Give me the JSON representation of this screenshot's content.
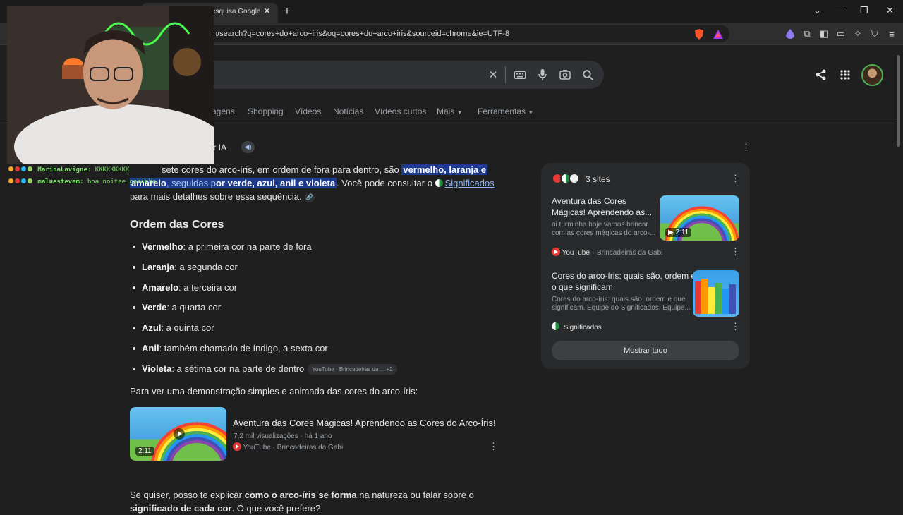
{
  "browser": {
    "tab_title": "esquisa Google",
    "url": "n/search?q=cores+do+arco+iris&oq=cores+do+arco+iris&sourceid=chrome&ie=UTF-8"
  },
  "search": {
    "clear_icon": "close-icon",
    "keyboard_icon": "keyboard-icon",
    "mic_icon": "mic-icon",
    "lens_icon": "lens-icon",
    "search_icon": "search-icon"
  },
  "nav": {
    "tabs": [
      "agens",
      "Shopping",
      "Vídeos",
      "Notícias",
      "Vídeos curtos",
      "Mais",
      "Ferramentas"
    ]
  },
  "ai_overview": {
    "label": "por IA",
    "intro_a": "sete cores do arco-íris, em ordem de fora para dentro, são",
    "intro_hl1": "vermelho, laranja e",
    "intro_hl2a": "amarelo",
    "intro_hl2b": ", seguidas p",
    "intro_hl2c": "or",
    "intro_hl2d": "verde, azul, anil e violeta",
    "intro_b": ". Você pode consultar o",
    "intro_link": "Significados",
    "intro_c": "para mais detalhes sobre essa sequência.",
    "heading": "Ordem das Cores",
    "items": [
      {
        "term": "Vermelho",
        "desc": ": a primeira cor na parte de fora"
      },
      {
        "term": "Laranja",
        "desc": ": a segunda cor"
      },
      {
        "term": "Amarelo",
        "desc": ": a terceira cor"
      },
      {
        "term": "Verde",
        "desc": ": a quarta cor"
      },
      {
        "term": "Azul",
        "desc": ": a quinta cor"
      },
      {
        "term": "Anil",
        "desc": ": também chamado de índigo, a sexta cor"
      },
      {
        "term": "Violeta",
        "desc": ": a sétima cor na parte de dentro"
      }
    ],
    "source_chip": "YouTube · Brincadeiras da ...  +2",
    "demo_text": "Para ver uma demonstração simples e animada das cores do arco-íris:",
    "video": {
      "title": "Aventura das Cores Mágicas! Aprendendo as Cores do Arco-Íris!",
      "meta": "7,2 mil visualizações · há 1 ano",
      "source": "YouTube · Brincadeiras da Gabi",
      "duration": "2:11"
    },
    "closing_a": "Se quiser, posso te explicar",
    "closing_b": "como o arco-íris se forma",
    "closing_c": "na natureza ou falar sobre o",
    "closing_d": "significado de cada cor",
    "closing_e": ". O que você prefere?"
  },
  "sources_panel": {
    "sites_label": "3 sites",
    "cards": [
      {
        "title1": "Aventura das Cores",
        "title2": "Mágicas! Aprendendo as...",
        "snip1": "oi turminha hoje vamos brincar",
        "snip2": "com as cores mágicas do arco-...",
        "source": "YouTube",
        "source_sub": "· Brincadeiras da Gabi",
        "duration": "2:11"
      },
      {
        "title1": "Cores do arco-íris: quais são, ordem e",
        "title2": "o que significam",
        "snip1": "Cores do arco-íris: quais são, ordem e que",
        "snip2": "significam. Equipe do Significados. Equipe...",
        "source": "Significados"
      }
    ],
    "show_all": "Mostrar tudo"
  },
  "overlay_chat": [
    {
      "name": "MarinaLavigne:",
      "msg": "KKKKKKKKK"
    },
    {
      "name": "maluestevam:",
      "msg": "boa noitee gabinho"
    }
  ]
}
